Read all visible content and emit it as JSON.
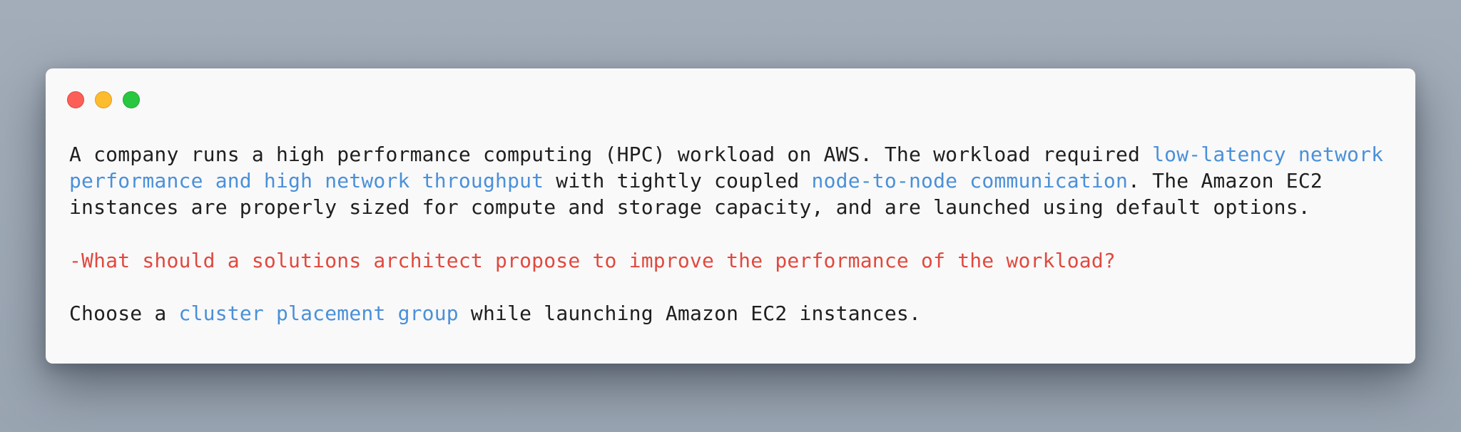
{
  "window": {
    "controls": {
      "close_color": "#fc5f57",
      "minimize_color": "#fdbc2e",
      "maximize_color": "#27c840"
    }
  },
  "content": {
    "paragraph1": {
      "t1": "A company runs a high performance computing (HPC) workload on AWS. The workload required ",
      "h1": "low-latency network performance and high network throughput",
      "t2": " with tightly coupled ",
      "h2": "node-to-node communication",
      "t3": ". The Amazon EC2 instances are properly sized for compute and storage capacity, and are launched using default options."
    },
    "question": "-What should a solutions architect propose to improve the performance of the workload?",
    "answer": {
      "t1": "Choose a ",
      "h1": "cluster placement group",
      "t2": " while launching Amazon EC2 instances."
    }
  },
  "colors": {
    "highlight": "#4a90d9",
    "question": "#e0493f",
    "text": "#1f1f1f"
  }
}
